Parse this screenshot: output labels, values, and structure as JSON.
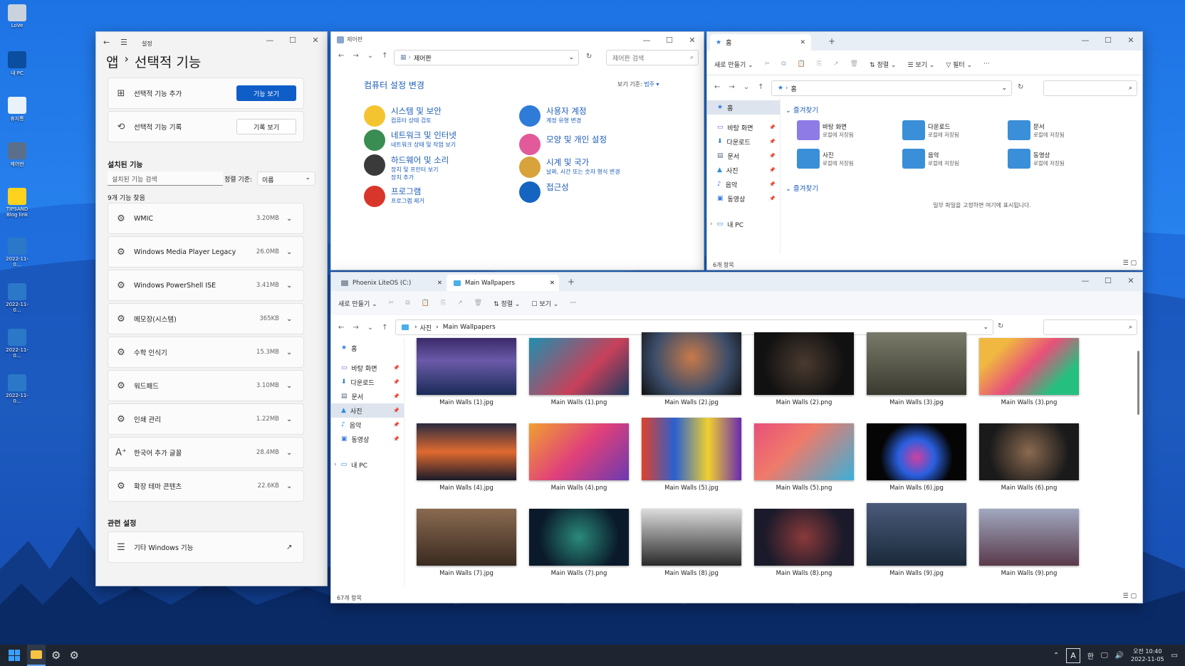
{
  "desktop": {
    "icons": [
      "LoVe",
      "내 PC",
      "휴지통",
      "제어판",
      "TIPSAND Blog link",
      "2022-11-0...",
      "2022-11-0...",
      "2022-11-0...",
      "2022-11-0..."
    ]
  },
  "settings": {
    "title": "설정",
    "crumb_root": "앱",
    "crumb_sep": "›",
    "page_title": "선택적 기능",
    "add_label": "선택적 기능 추가",
    "add_btn": "기능 보기",
    "history_label": "선택적 기능 기록",
    "history_btn": "기록 보기",
    "installed_heading": "설치된 기능",
    "search_placeholder": "설치된 기능 검색",
    "sort_label": "정렬 기준:",
    "sort_value": "이름",
    "count": "9개 기능 찾음",
    "features": [
      {
        "name": "WMIC",
        "size": "3.20MB"
      },
      {
        "name": "Windows Media Player Legacy",
        "size": "26.0MB"
      },
      {
        "name": "Windows PowerShell ISE",
        "size": "3.41MB"
      },
      {
        "name": "메모장(시스템)",
        "size": "365KB"
      },
      {
        "name": "수학 인식기",
        "size": "15.3MB"
      },
      {
        "name": "워드패드",
        "size": "3.10MB"
      },
      {
        "name": "인쇄 관리",
        "size": "1.22MB"
      },
      {
        "name": "한국어 추가 글꼴",
        "size": "28.4MB"
      },
      {
        "name": "확장 테마 콘텐츠",
        "size": "22.6KB"
      }
    ],
    "related_heading": "관련 설정",
    "related_item": "기타 Windows 기능"
  },
  "control_panel": {
    "title": "제어판",
    "address": "제어판",
    "search": "제어판 검색",
    "heading": "컴퓨터 설정 변경",
    "view_label": "보기 기준:",
    "view_value": "범주 ▾",
    "items": [
      {
        "title": "시스템 및 보안",
        "subs": [
          "컴퓨터 상태 검토"
        ],
        "color": "#f4c430"
      },
      {
        "title": "네트워크 및 인터넷",
        "subs": [
          "네트워크 상태 및 작업 보기"
        ],
        "color": "#3a8d52"
      },
      {
        "title": "하드웨어 및 소리",
        "subs": [
          "장치 및 프린터 보기",
          "장치 추가"
        ],
        "color": "#3a3a3a"
      },
      {
        "title": "프로그램",
        "subs": [
          "프로그램 제거"
        ],
        "color": "#d9362b"
      },
      {
        "title": "사용자 계정",
        "subs": [
          "계정 유형 변경"
        ],
        "color": "#2e7bd8"
      },
      {
        "title": "모양 및 개인 설정",
        "subs": [],
        "color": "#e25a9a"
      },
      {
        "title": "시계 및 국가",
        "subs": [
          "날짜, 시간 또는 숫자 형식 변경"
        ],
        "color": "#d8a33a"
      },
      {
        "title": "접근성",
        "subs": [],
        "color": "#1565c0"
      }
    ]
  },
  "home_explorer": {
    "tab": "홈",
    "new_tab": "+",
    "cmd": [
      "새로 만들기 ⌄",
      "✂",
      "⧉",
      "📋",
      "⎘",
      "↗",
      "🗑",
      "⇅ 정렬 ⌄",
      "☰ 보기 ⌄",
      "▽ 필터 ⌄",
      "···"
    ],
    "address": "홈",
    "nav": [
      "홈",
      "바탕 화면",
      "다운로드",
      "문서",
      "사진",
      "음악",
      "동영상",
      "내 PC"
    ],
    "fav_heading": "즐겨찾기",
    "favorites": [
      {
        "name": "바탕 화면",
        "sub": "로컬에 저장됨"
      },
      {
        "name": "다운로드",
        "sub": "로컬에 저장됨"
      },
      {
        "name": "문서",
        "sub": "로컬에 저장됨"
      },
      {
        "name": "사진",
        "sub": "로컬에 저장됨"
      },
      {
        "name": "음악",
        "sub": "로컬에 저장됨"
      },
      {
        "name": "동영상",
        "sub": "로컬에 저장됨"
      }
    ],
    "recent_heading": "즐겨찾기",
    "empty_msg": "일부 파일을 고정하면 여기에 표시됩니다.",
    "status": "6개 항목"
  },
  "wall_explorer": {
    "tab1": "Phoenix LiteOS (C:)",
    "tab2": "Main Wallpapers",
    "new_tab": "+",
    "cmd": [
      "새로 만들기 ⌄",
      "✂",
      "⧉",
      "📋",
      "⎘",
      "↗",
      "🗑",
      "⇅ 정렬 ⌄",
      "☐ 보기 ⌄",
      "···"
    ],
    "address": [
      "사진",
      "Main Wallpapers"
    ],
    "nav": [
      "홈",
      "바탕 화면",
      "다운로드",
      "문서",
      "사진",
      "음악",
      "동영상",
      "내 PC"
    ],
    "files": [
      "Main Walls (1).jpg",
      "Main Walls (1).png",
      "Main Walls (2).jpg",
      "Main Walls (2).png",
      "Main Walls (3).jpg",
      "Main Walls (3).png",
      "Main Walls (4).jpg",
      "Main Walls (4).png",
      "Main Walls (5).jpg",
      "Main Walls (5).png",
      "Main Walls (6).jpg",
      "Main Walls (6).png",
      "Main Walls (7).jpg",
      "Main Walls (7).png",
      "Main Walls (8).jpg",
      "Main Walls (8).png",
      "Main Walls (9).jpg",
      "Main Walls (9).png"
    ],
    "status": "67개 항목"
  },
  "taskbar": {
    "ime": "A",
    "lang": "한",
    "time": "오전 10:40",
    "date": "2022-11-05"
  }
}
